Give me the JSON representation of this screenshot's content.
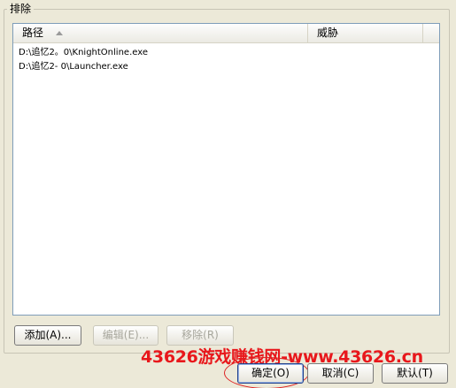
{
  "group": {
    "title": "排除"
  },
  "list": {
    "columns": [
      {
        "label": "路径",
        "sorted": "ascending"
      },
      {
        "label": "威胁"
      }
    ],
    "rows": [
      "D:\\追忆2。0\\KnightOnline.exe",
      "D:\\追忆2- 0\\Launcher.exe"
    ]
  },
  "buttons": {
    "add": "添加(A)...",
    "edit": "编辑(E)...",
    "remove": "移除(R)",
    "ok": "确定(O)",
    "cancel": "取消(C)",
    "default": "默认(T)"
  },
  "watermark": "43626游戏赚钱网-www.43626.cn",
  "colors": {
    "background": "#ECE9D8",
    "list_border": "#7F9DB9",
    "watermark": "#E8171B",
    "disabled_text": "#A7A69C"
  }
}
